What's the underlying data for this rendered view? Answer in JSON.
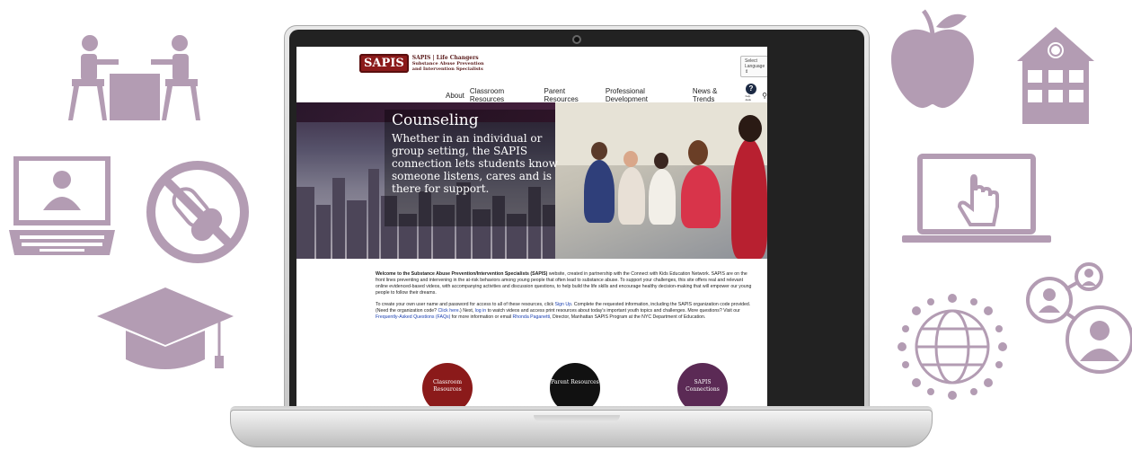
{
  "colors": {
    "icon_purple": "#b39cb3",
    "brand_red": "#8b1a1a",
    "circle_red": "#8b1a1a",
    "circle_black": "#111111",
    "circle_purple": "#5b2a55"
  },
  "decor_icons": [
    "meeting-icon",
    "laptop-user-icon",
    "no-drugs-icon",
    "graduation-cap-icon",
    "apple-icon",
    "school-icon",
    "laptop-pointer-icon",
    "globe-network-icon",
    "user-network-icon"
  ],
  "site": {
    "logo_mark": "SAPIS",
    "logo_tagline": "SAPIS | Life Changers",
    "logo_line2": "Substance Abuse Prevention",
    "logo_line3": "and Intervention Specialists",
    "language_select": "Select Language",
    "nav": [
      "About",
      "Classroom Resources",
      "Parent Resources",
      "Professional Development",
      "News & Trends"
    ],
    "help_label": "help desk",
    "hero_title": "Counseling",
    "hero_text": "Whether in an individual or group setting, the SAPIS connection lets students know someone listens, cares and is there for support.",
    "intro_bold": "Welcome to the Substance Abuse Prevention/Intervention Specialists (SAPIS)",
    "intro_rest": " website, created in partnership with the Connect with Kids Education Network. SAPIS are on the front lines preventing and intervening in the at-risk behaviors among young people that often lead to substance abuse. To support your challenges, this site offers real and relevant online evidenced-based videos, with accompanying activities and discussion questions, to help build the life skills and encourage healthy decision-making that will empower our young people to follow their dreams.",
    "p2_a": "To create your own user name and password for access to all of these resources, click ",
    "p2_signup": "Sign Up",
    "p2_b": ". Complete the requested information, including the SAPIS organization code provided. (Need the organization code? ",
    "p2_click": "Click here",
    "p2_c": ".) Next, ",
    "p2_login": "log in",
    "p2_d": " to watch videos and access print resources about today's important youth topics and challenges. More questions? Visit our ",
    "p2_faq": "Frequently-Asked Questions (FAQs)",
    "p2_e": " for more information or email ",
    "p2_email": "Rhonda Paganetti",
    "p2_f": ", Director, Manhattan SAPIS Program at the NYC Department of Education.",
    "circles": [
      {
        "label": "Classroom Resources"
      },
      {
        "label": "Parent Resources"
      },
      {
        "label": "SAPIS Connections"
      }
    ]
  }
}
